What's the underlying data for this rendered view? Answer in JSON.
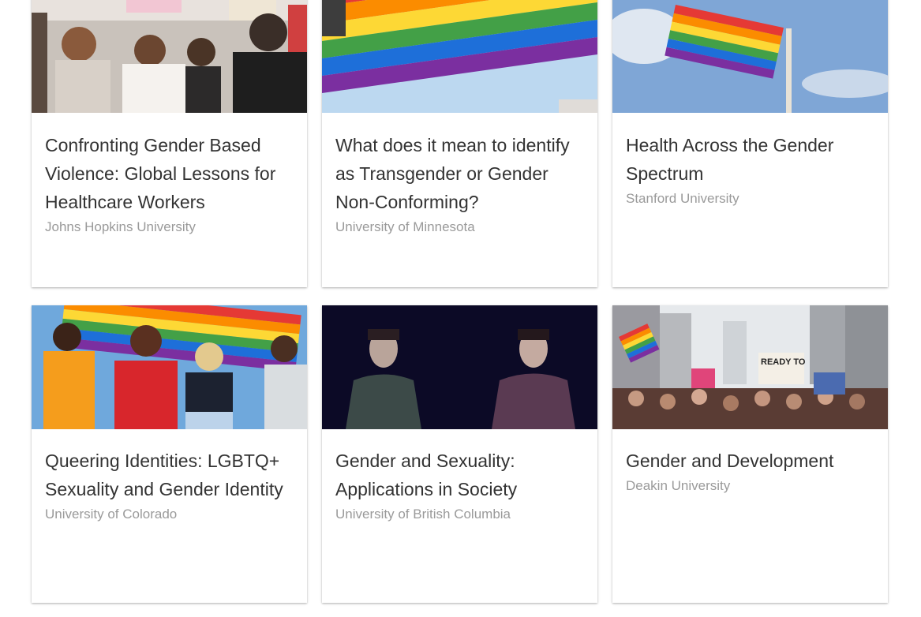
{
  "courses": [
    {
      "title": "Confronting Gender Based Violence: Global Lessons for Healthcare Workers",
      "org": "Johns Hopkins University",
      "image_icon": "protest-crowd-image"
    },
    {
      "title": "What does it mean to identify as Transgender or Gender Non-Conforming?",
      "org": "University of Minnesota",
      "image_icon": "rainbow-flag-image"
    },
    {
      "title": "Health Across the Gender Spectrum",
      "org": "Stanford University",
      "image_icon": "flag-on-pole-image"
    },
    {
      "title": "Queering Identities: LGBTQ+ Sexuality and Gender Identity",
      "org": "University of Colorado",
      "image_icon": "pride-celebration-image"
    },
    {
      "title": "Gender and Sexuality: Applications in Society",
      "org": "University of British Columbia",
      "image_icon": "two-faces-dark-image"
    },
    {
      "title": "Gender and Development",
      "org": "Deakin University",
      "image_icon": "city-march-image",
      "sign_text": "READY TO"
    }
  ],
  "colors": {
    "title": "#333333",
    "org": "#9a9a9a",
    "card_bg": "#ffffff"
  }
}
